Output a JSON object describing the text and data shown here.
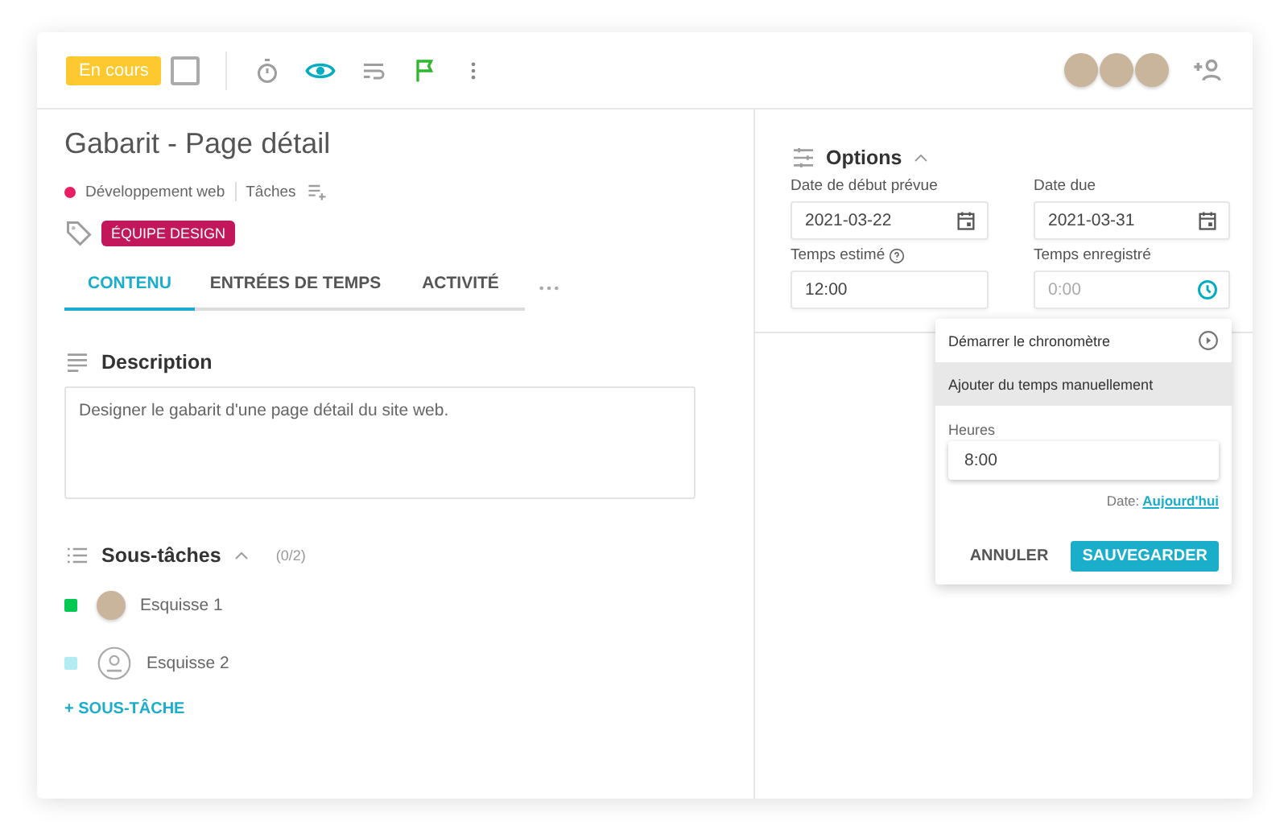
{
  "toolbar": {
    "status": "En cours",
    "checked": false,
    "watching": true,
    "flagged": true,
    "assignees": [
      {
        "kind": "photo"
      },
      {
        "kind": "photo"
      },
      {
        "kind": "photo"
      }
    ]
  },
  "task": {
    "title": "Gabarit - Page détail",
    "project": {
      "name": "Développement web",
      "color": "#e91e63"
    },
    "list": "Tâches",
    "tags": [
      {
        "label": "ÉQUIPE DESIGN",
        "color": "#c2185b"
      }
    ]
  },
  "tabs": [
    {
      "label": "CONTENU",
      "selected": true
    },
    {
      "label": "ENTRÉES DE TEMPS",
      "selected": false
    },
    {
      "label": "ACTIVITÉ",
      "selected": false
    }
  ],
  "description": {
    "heading": "Description",
    "text": "Designer le gabarit d'une page détail du site web."
  },
  "subtasks": {
    "heading": "Sous-tâches",
    "count": "(0/2)",
    "expanded": true,
    "items": [
      {
        "name": "Esquisse 1",
        "color": "#00c853",
        "kind": "photo"
      },
      {
        "name": "Esquisse 2",
        "color": "#b2ebf2",
        "kind": "unassigned"
      }
    ],
    "add": "+ SOUS-TÂCHE"
  },
  "options": {
    "heading": "Options",
    "expanded": true,
    "fields": [
      {
        "label": "Date de début prévue",
        "value": "2021-03-22",
        "kind": "date"
      },
      {
        "label": "Date due",
        "value": "2021-03-31",
        "kind": "date"
      },
      {
        "label": "Temps estimé",
        "value": "12:00",
        "kind": "help"
      },
      {
        "label": "Temps enregistré",
        "placeholder": "0:00",
        "kind": "timer"
      }
    ]
  },
  "popover": {
    "items": [
      {
        "label": "Démarrer le chronomètre",
        "selected": false
      },
      {
        "label": "Ajouter du temps manuellement",
        "selected": true
      }
    ],
    "hours_label": "Heures",
    "hours": "8:00",
    "date_label": "Date:",
    "date_link": "Aujourd'hui",
    "cancel": "ANNULER",
    "save": "SAUVEGARDER"
  }
}
